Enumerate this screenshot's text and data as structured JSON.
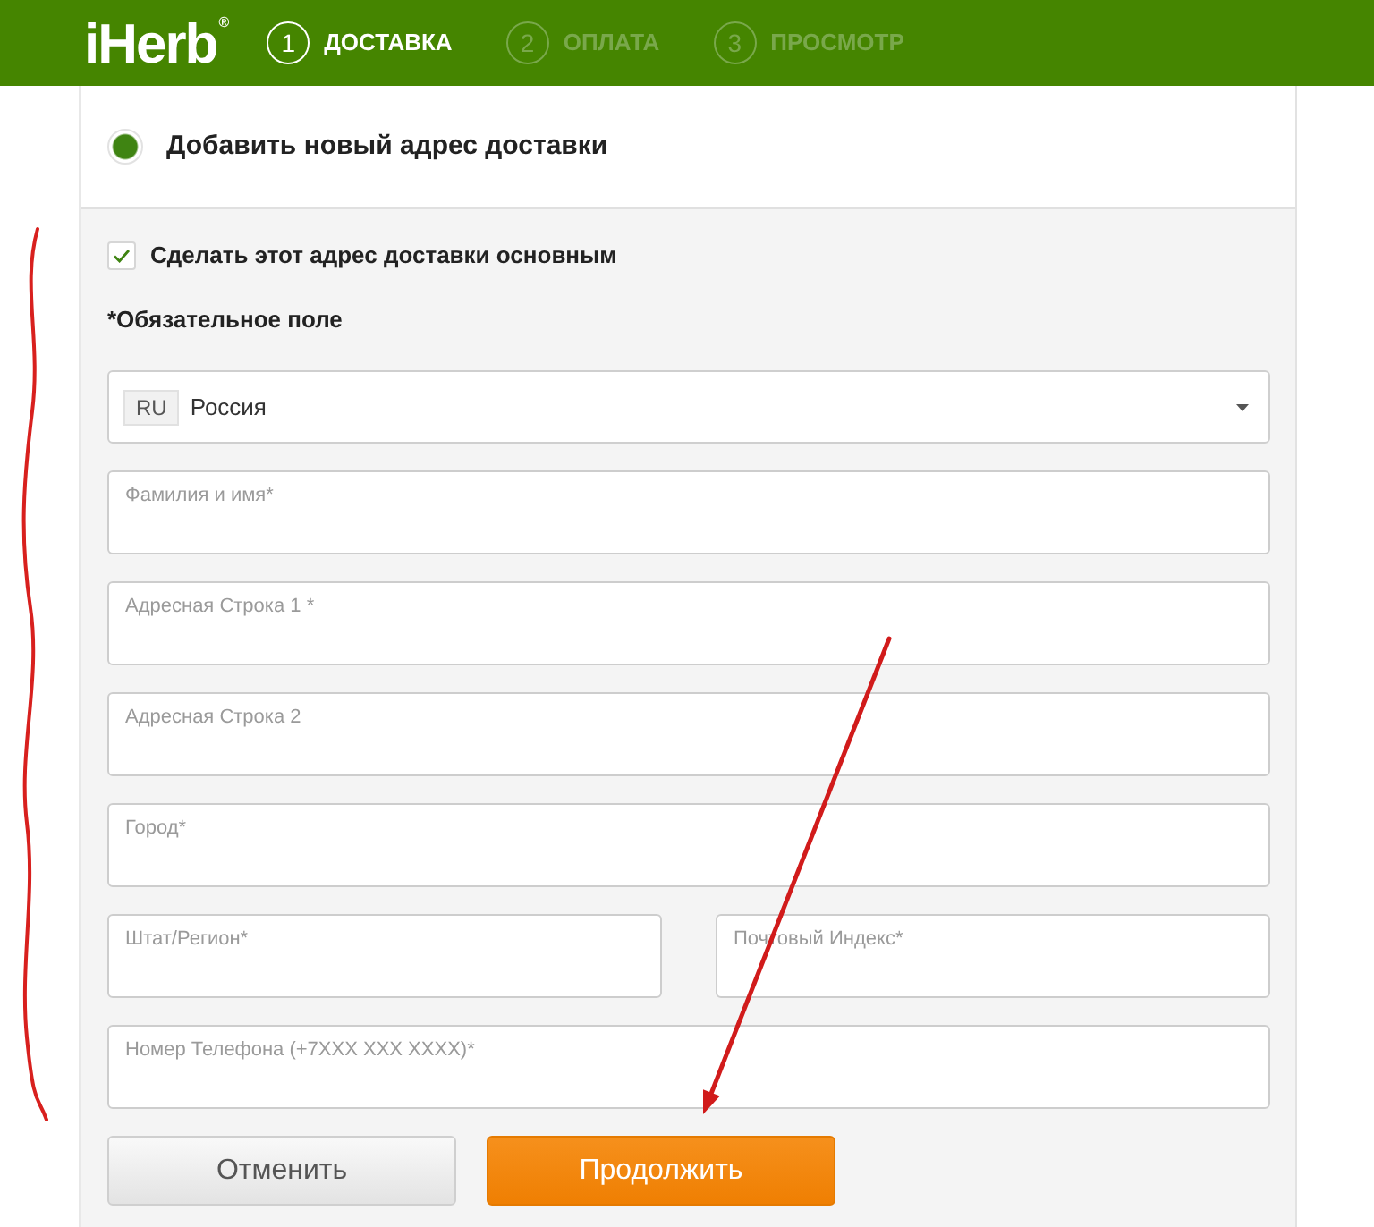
{
  "header": {
    "logo": "iHerb$^{®}$",
    "steps": [
      {
        "number": "1",
        "label": "ДОСТАВКА",
        "selected": true
      },
      {
        "number": "2",
        "label": "ОПЛАТА",
        "selected": false
      },
      {
        "number": "3",
        "label": "ПРОСМОТР",
        "selected": false
      }
    ]
  },
  "address_option": {
    "label": "Добавить новый адрес доставки",
    "selected": true
  },
  "form": {
    "default_checkbox": {
      "label": "Сделать этот адрес доставки основным",
      "checked": true
    },
    "required_note": "*Обязательное поле",
    "country_select": {
      "code": "RU",
      "value": "Россия"
    },
    "rows": [
      [
        {
          "placeholder": "Фамилия и имя*"
        }
      ],
      [
        {
          "placeholder": "Адресная Строка 1 *"
        }
      ],
      [
        {
          "placeholder": "Адресная Строка 2"
        }
      ],
      [
        {
          "placeholder": "Город*"
        }
      ],
      [
        {
          "placeholder": "Штат/Регион*"
        },
        {
          "placeholder": "Почтовый Индекс*"
        }
      ],
      [
        {
          "placeholder": "Номер Телефона (+7XXX XXX XXXX)*"
        }
      ]
    ],
    "buttons": [
      {
        "kind": "secondary",
        "label": "Отменить"
      },
      {
        "kind": "primary",
        "label": "Продолжить"
      }
    ]
  }
}
